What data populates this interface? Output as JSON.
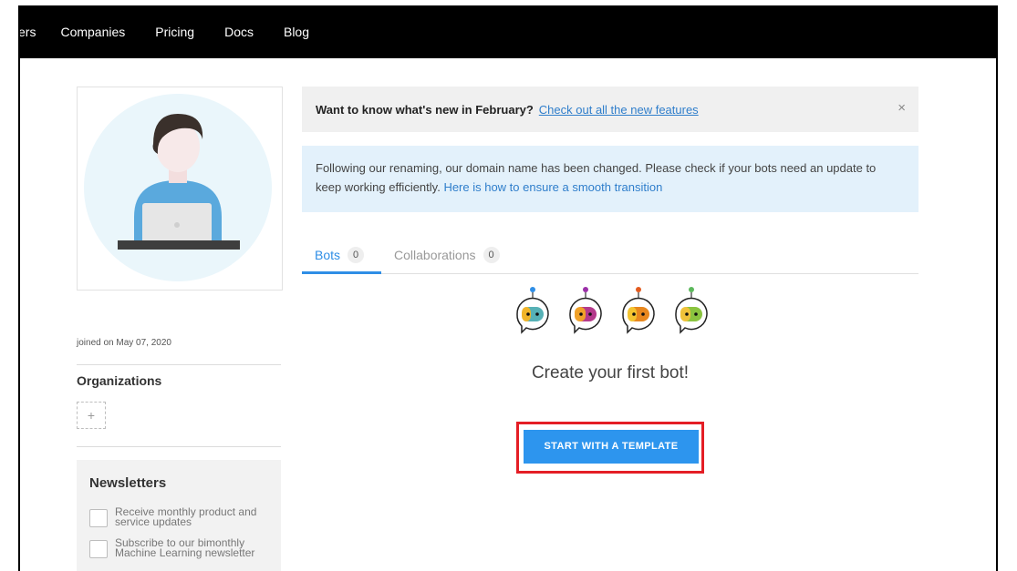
{
  "nav": {
    "items": [
      "ers",
      "Companies",
      "Pricing",
      "Docs",
      "Blog"
    ]
  },
  "profile": {
    "joined": "joined on May 07, 2020"
  },
  "organizations": {
    "title": "Organizations",
    "add_symbol": "+"
  },
  "newsletters": {
    "title": "Newsletters",
    "items": [
      "Receive monthly product and service updates",
      "Subscribe to our bimonthly Machine Learning newsletter"
    ]
  },
  "banner_feature": {
    "bold": "Want to know what's new in February?",
    "link": "Check out all the new features",
    "close": "×"
  },
  "banner_info": {
    "text": "Following our renaming, our domain name has been changed. Please check if your bots need an update to keep working efficiently.",
    "link": "Here is how to ensure a smooth transition"
  },
  "tabs": [
    {
      "label": "Bots",
      "count": "0"
    },
    {
      "label": "Collaborations",
      "count": "0"
    }
  ],
  "empty_state": {
    "title": "Create your first bot!",
    "cta": "START WITH A TEMPLATE"
  },
  "colors": {
    "accent": "#2f8ee6",
    "highlight": "#e41e25"
  }
}
